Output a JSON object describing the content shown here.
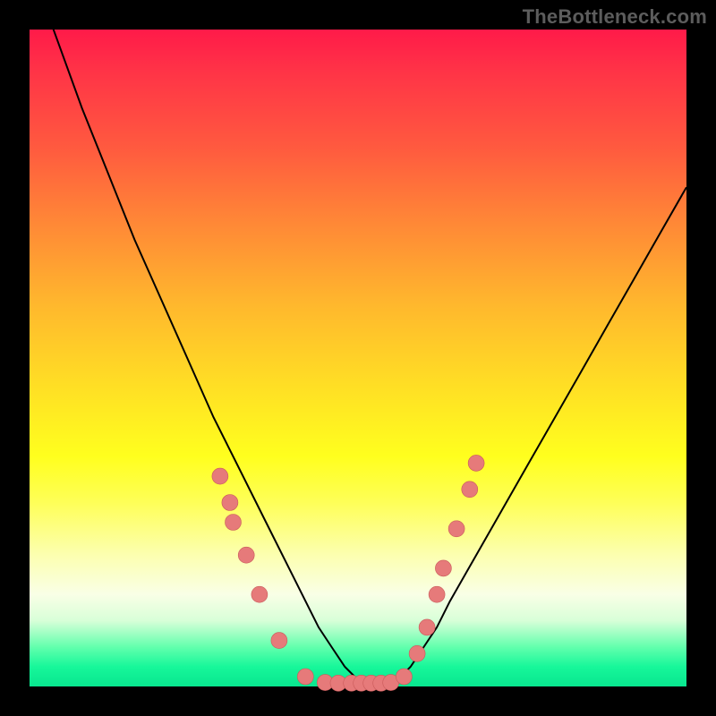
{
  "watermark": "TheBottleneck.com",
  "colors": {
    "frame": "#000000",
    "gradient_top": "#ff1a49",
    "gradient_bottom": "#08e68f",
    "curve": "#000000",
    "dot_fill": "#e67a7a",
    "dot_stroke": "#c95a5a"
  },
  "chart_data": {
    "type": "line",
    "title": "",
    "xlabel": "",
    "ylabel": "",
    "xlim": [
      0,
      100
    ],
    "ylim": [
      0,
      100
    ],
    "x": [
      0,
      4,
      8,
      12,
      16,
      20,
      24,
      28,
      32,
      36,
      40,
      42,
      44,
      46,
      48,
      50,
      52,
      54,
      56,
      58,
      60,
      62,
      64,
      68,
      72,
      76,
      80,
      84,
      88,
      92,
      96,
      100
    ],
    "values": [
      110,
      99,
      88,
      78,
      68,
      59,
      50,
      41,
      33,
      25,
      17,
      13,
      9,
      6,
      3,
      1,
      0,
      0,
      1,
      3,
      6,
      9,
      13,
      20,
      27,
      34,
      41,
      48,
      55,
      62,
      69,
      76
    ],
    "note": "Values are percentage (0 = best/green bottom, 100 = worst/red top). Curve is asymmetric V with minimum near x≈52.",
    "markers": {
      "x": [
        29,
        30.5,
        31,
        33,
        35,
        38,
        42,
        45,
        47,
        49,
        50.5,
        52,
        53.5,
        55,
        57,
        59,
        60.5,
        62,
        63,
        65,
        67,
        68
      ],
      "y": [
        32,
        28,
        25,
        20,
        14,
        7,
        1.5,
        0.6,
        0.5,
        0.5,
        0.5,
        0.5,
        0.5,
        0.6,
        1.5,
        5,
        9,
        14,
        18,
        24,
        30,
        34
      ],
      "style": "scatter"
    }
  }
}
